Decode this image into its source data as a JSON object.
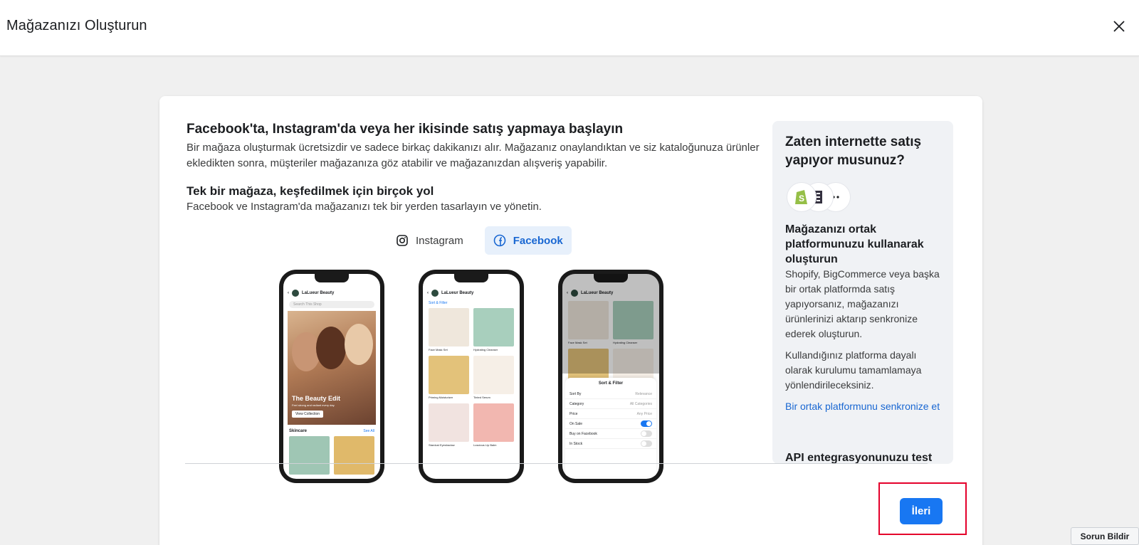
{
  "header": {
    "title": "Mağazanızı Oluşturun",
    "close_icon": "close-icon"
  },
  "main": {
    "heading": "Facebook'ta, Instagram'da veya her ikisinde satış yapmaya başlayın",
    "description": "Bir mağaza oluşturmak ücretsizdir ve sadece birkaç dakikanızı alır. Mağazanız onaylandıktan ve siz kataloğunuza ürünler ekledikten sonra, müşteriler mağazanıza göz atabilir ve mağazanızdan alışveriş yapabilir.",
    "subheading": "Tek bir mağaza, keşfedilmek için birçok yol",
    "subdescription": "Facebook ve Instagram'da mağazanızı tek bir yerden tasarlayın ve yönetin.",
    "tabs": [
      {
        "label": "Instagram",
        "icon": "instagram-icon",
        "active": false
      },
      {
        "label": "Facebook",
        "icon": "facebook-icon",
        "active": true
      }
    ],
    "phones": {
      "brand": "LaLueur Beauty",
      "search": "Search This Shop",
      "hero_title": "The Beauty Edit",
      "hero_sub": "Feel strong and radiant every day.",
      "hero_button": "View Collection",
      "section": "Skincare",
      "see_all": "See All",
      "sort_filter": "Sort & Filter",
      "products": [
        "Face Mask Set",
        "Hydrating Cleanser",
        "Priming Moisturizer",
        "Tinted Serum",
        "Stardust Eyeshadow",
        "Luscious Lip Balm"
      ],
      "filter_rows": [
        {
          "label": "Sort By",
          "value": "Relevance"
        },
        {
          "label": "Category",
          "value": "All Categories"
        },
        {
          "label": "Price",
          "value": "Any Price"
        },
        {
          "label": "On Sale",
          "toggle": true
        },
        {
          "label": "Buy on Facebook",
          "toggle": false
        },
        {
          "label": "In Stock",
          "toggle": false
        }
      ]
    }
  },
  "side": {
    "heading": "Zaten internette satış yapıyor musunuz?",
    "partner_heading": "Mağazanızı ortak platformunuzu kullanarak oluşturun",
    "paragraph1": "Shopify, BigCommerce veya başka bir ortak platformda satış yapıyorsanız, mağazanızı ürünlerinizi aktarıp senkronize ederek oluşturun.",
    "paragraph2": "Kullandığınız platforma dayalı olarak kurulumu tamamlamaya yönlendirileceksiniz.",
    "link": "Bir ortak platformunu senkronize et",
    "api_heading": "API entegrasyonunuzu test"
  },
  "footer": {
    "next_label": "İleri",
    "report_label": "Sorun Bildir"
  },
  "colors": {
    "accent": "#1877f2",
    "highlight": "#e4002b",
    "link": "#1967d2"
  }
}
